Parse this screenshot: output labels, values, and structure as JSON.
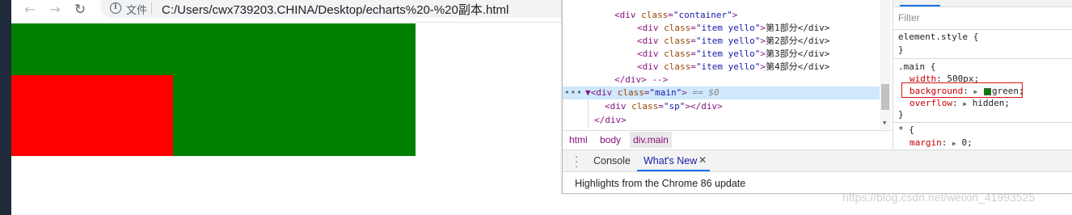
{
  "browser": {
    "back_icon": "←",
    "forward_icon": "→",
    "reload_icon": "↻",
    "info_icon": "i",
    "file_label": "文件",
    "url": "C:/Users/cwx739203.CHINA/Desktop/echarts%20-%20副本.html"
  },
  "page": {
    "main_color": "#008000",
    "sp_color": "#ff0000"
  },
  "devtools": {
    "elements": {
      "lines": [
        {
          "open": "<div ",
          "attr": "class",
          "val": "\"container\"",
          "close": ">",
          "text": ""
        },
        {
          "open": "<div ",
          "attr": "class",
          "val": "\"item yello\"",
          "close": ">",
          "text": "第1部分</div>"
        },
        {
          "open": "<div ",
          "attr": "class",
          "val": "\"item yello\"",
          "close": ">",
          "text": "第2部分</div>"
        },
        {
          "open": "<div ",
          "attr": "class",
          "val": "\"item yello\"",
          "close": ">",
          "text": "第3部分</div>"
        },
        {
          "open": "<div ",
          "attr": "class",
          "val": "\"item yello\"",
          "close": ">",
          "text": "第4部分</div>"
        },
        {
          "open": "</div> -->",
          "attr": "",
          "val": "",
          "close": "",
          "text": ""
        },
        {
          "open": "▼<div ",
          "attr": "class",
          "val": "\"main\"",
          "close": ">",
          "text": " == $0"
        },
        {
          "open": "<div ",
          "attr": "class",
          "val": "\"sp\"",
          "close": "></div>",
          "text": ""
        },
        {
          "open": "</div>",
          "attr": "",
          "val": "",
          "close": "",
          "text": ""
        }
      ],
      "dots": "•••"
    },
    "breadcrumbs": [
      "html",
      "body",
      "div.main"
    ],
    "styles": {
      "filter_placeholder": "Filter",
      "element_style": "element.style {",
      "element_style_close": "}",
      "main_selector": ".main {",
      "width_prop": "width",
      "width_val": "500px;",
      "background_prop": "background",
      "background_val": "green;",
      "overflow_prop": "overflow",
      "overflow_val": "hidden;",
      "main_close": "}",
      "star_selector": "* {",
      "margin_prop": "margin",
      "margin_val": "0;"
    },
    "drawer": {
      "tabs": [
        "Console",
        "What's New"
      ],
      "close_icon": "✕",
      "message": "Highlights from the Chrome 86 update"
    }
  },
  "watermark": "https://blog.csdn.net/weixin_41993525"
}
